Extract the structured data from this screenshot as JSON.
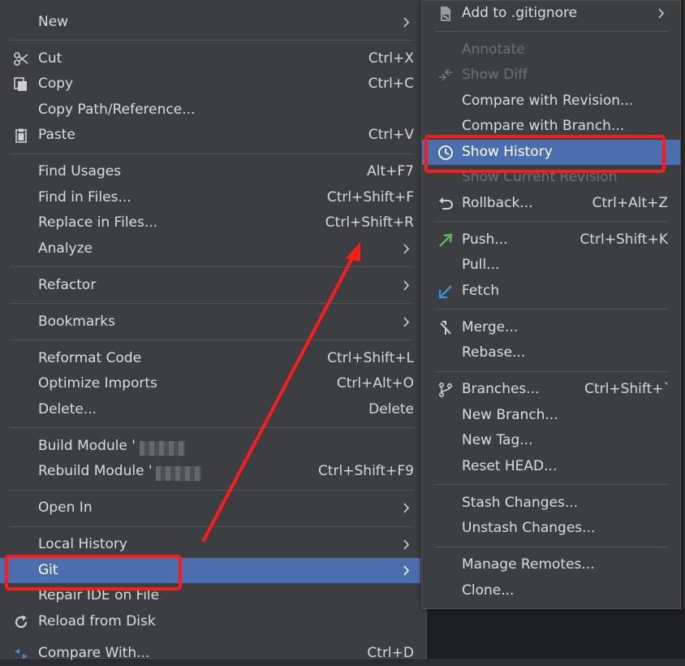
{
  "left_menu": {
    "items": [
      {
        "label": "New",
        "shortcut": "",
        "has_arrow": true
      },
      {
        "label": "Cut",
        "shortcut": "Ctrl+X",
        "icon": "scissors-icon"
      },
      {
        "label": "Copy",
        "shortcut": "Ctrl+C",
        "icon": "copy-icon"
      },
      {
        "label": "Copy Path/Reference...",
        "shortcut": ""
      },
      {
        "label": "Paste",
        "shortcut": "Ctrl+V",
        "icon": "clipboard-icon"
      },
      {
        "label": "Find Usages",
        "shortcut": "Alt+F7"
      },
      {
        "label": "Find in Files...",
        "shortcut": "Ctrl+Shift+F"
      },
      {
        "label": "Replace in Files...",
        "shortcut": "Ctrl+Shift+R"
      },
      {
        "label": "Analyze",
        "shortcut": "",
        "has_arrow": true
      },
      {
        "label": "Refactor",
        "shortcut": "",
        "has_arrow": true
      },
      {
        "label": "Bookmarks",
        "shortcut": "",
        "has_arrow": true
      },
      {
        "label": "Reformat Code",
        "shortcut": "Ctrl+Shift+L"
      },
      {
        "label": "Optimize Imports",
        "shortcut": "Ctrl+Alt+O"
      },
      {
        "label": "Delete...",
        "shortcut": "Delete"
      },
      {
        "label": "Build Module '",
        "shortcut": ""
      },
      {
        "label": "Rebuild Module '",
        "shortcut": "Ctrl+Shift+F9"
      },
      {
        "label": "Open In",
        "shortcut": "",
        "has_arrow": true
      },
      {
        "label": "Local History",
        "shortcut": "",
        "has_arrow": true
      },
      {
        "label": "Git",
        "shortcut": "",
        "has_arrow": true,
        "selected": true
      },
      {
        "label": "Repair IDE on File",
        "shortcut": ""
      },
      {
        "label": "Reload from Disk",
        "shortcut": "",
        "icon": "reload-icon"
      },
      {
        "label": "Compare With...",
        "shortcut": "Ctrl+D",
        "icon": "compare-icon"
      }
    ]
  },
  "git_submenu": {
    "items": [
      {
        "label": "Add to .gitignore",
        "shortcut": "",
        "has_arrow": true,
        "icon": "gitignore-file-icon"
      },
      {
        "label": "Annotate",
        "shortcut": "",
        "disabled": true
      },
      {
        "label": "Show Diff",
        "shortcut": "",
        "disabled": true,
        "icon": "diff-icon"
      },
      {
        "label": "Compare with Revision...",
        "shortcut": ""
      },
      {
        "label": "Compare with Branch...",
        "shortcut": ""
      },
      {
        "label": "Show History",
        "shortcut": "",
        "selected": true,
        "icon": "clock-icon"
      },
      {
        "label": "Show Current Revision",
        "shortcut": "",
        "disabled": true
      },
      {
        "label": "Rollback...",
        "shortcut": "Ctrl+Alt+Z",
        "icon": "rollback-icon"
      },
      {
        "label": "Push...",
        "shortcut": "Ctrl+Shift+K",
        "icon": "push-arrow-icon"
      },
      {
        "label": "Pull...",
        "shortcut": ""
      },
      {
        "label": "Fetch",
        "shortcut": "",
        "icon": "fetch-arrow-icon"
      },
      {
        "label": "Merge...",
        "shortcut": "",
        "icon": "merge-icon"
      },
      {
        "label": "Rebase...",
        "shortcut": ""
      },
      {
        "label": "Branches...",
        "shortcut": "Ctrl+Shift+`",
        "icon": "branch-icon"
      },
      {
        "label": "New Branch...",
        "shortcut": ""
      },
      {
        "label": "New Tag...",
        "shortcut": ""
      },
      {
        "label": "Reset HEAD...",
        "shortcut": ""
      },
      {
        "label": "Stash Changes...",
        "shortcut": ""
      },
      {
        "label": "Unstash Changes...",
        "shortcut": ""
      },
      {
        "label": "Manage Remotes...",
        "shortcut": ""
      },
      {
        "label": "Clone...",
        "shortcut": ""
      }
    ]
  },
  "colors": {
    "menu_bg": "#3c3f41",
    "selection": "#4b6eaf",
    "annotation_red": "#ff1a1a",
    "push_green": "#5fb85a",
    "fetch_blue": "#3d8fd8"
  }
}
